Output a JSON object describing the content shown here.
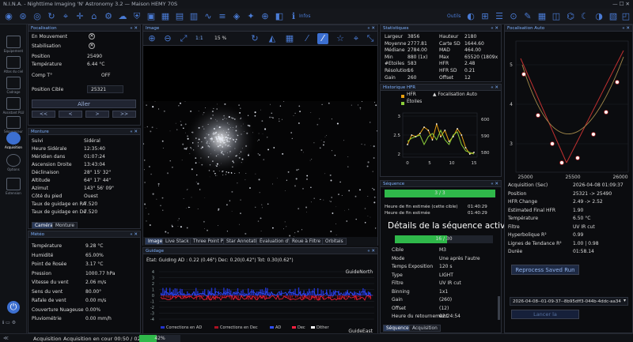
{
  "app": {
    "title": "N.I.N.A. - Nighttime Imaging 'N' Astronomy 3.2  —  Maison HEMY 70S",
    "outils": "Outils",
    "infos": "Infos"
  },
  "sidebar": {
    "items": [
      {
        "label": "Equipement"
      },
      {
        "label": "Atlas du ciel"
      },
      {
        "label": "Cadrage"
      },
      {
        "label": "Assistant PLU"
      },
      {
        "label": "Séquenceur"
      },
      {
        "label": "Acquisition"
      },
      {
        "label": "Options"
      },
      {
        "label": "Extension"
      }
    ]
  },
  "focuser": {
    "title": "Focalisation",
    "moving_label": "En Mouvement",
    "stab_label": "Stabilisation",
    "pos_label": "Position",
    "pos_value": "25490",
    "temp_label": "Température",
    "temp_value": "6.44 °C",
    "comp_label": "Comp T°",
    "comp_value": "OFF",
    "target_label": "Position Cible",
    "target_value": "25321",
    "aller": "Aller",
    "b1": "<<",
    "b2": "<",
    "b3": ">",
    "b4": ">>"
  },
  "mount": {
    "title": "Monture",
    "rows": [
      {
        "k": "Suivi",
        "v": "Sidéral"
      },
      {
        "k": "Heure Sidérale",
        "v": "12:35:40"
      },
      {
        "k": "Méridien dans",
        "v": "01:07:24"
      },
      {
        "k": "Ascension Droite",
        "v": "13:43:04"
      },
      {
        "k": "Déclinaison",
        "v": "28° 15' 32\""
      },
      {
        "k": "Altitude",
        "v": "64° 17' 44\""
      },
      {
        "k": "Azimut",
        "v": "143° 56' 09\""
      },
      {
        "k": "Côté du pied",
        "v": "Ouest"
      },
      {
        "k": "Taux de guidage en RA",
        "v": "7.520"
      },
      {
        "k": "Taux de guidage en De",
        "v": "7.520"
      }
    ],
    "tabs": [
      "Caméra",
      "Monture"
    ]
  },
  "weather": {
    "title": "Météo",
    "rows": [
      {
        "k": "Température",
        "v": "9.28 °C"
      },
      {
        "k": "Humidité",
        "v": "65.00%"
      },
      {
        "k": "Point de Rosée",
        "v": "3.17 °C"
      },
      {
        "k": "Pression",
        "v": "1000.77 hPa"
      },
      {
        "k": "Vitesse du vent",
        "v": "2.06 m/s"
      },
      {
        "k": "Sens du vent",
        "v": "80.00°"
      },
      {
        "k": "Rafale de vent",
        "v": "0.00 m/s"
      },
      {
        "k": "Couverture Nuageuse",
        "v": "0.00%"
      },
      {
        "k": "Pluviométrie",
        "v": "0.00 mm/h"
      }
    ]
  },
  "image": {
    "title": "Image",
    "zoom_fit": "1:1",
    "zoom_pct": "15 %",
    "tabs": [
      "Image",
      "Live Stack",
      "Three Point P",
      "Star Annotati",
      "Évaluation d'",
      "Roue à Filtre",
      "Orbitals"
    ]
  },
  "guiding": {
    "title": "Guidage",
    "status": "État: Guiding  AD : 0.22 (0.46\")  Dec: 0.20(0.42\")  Tot: 0.30(0.62\")",
    "north": "GuideNorth",
    "east": "GuideEast",
    "yticks": [
      "4",
      "3",
      "2",
      "1",
      "0",
      "-1",
      "-2",
      "-3",
      "-4"
    ],
    "legend": [
      "Corrections en AD",
      "Corrections en Dec",
      "AD",
      "Dec",
      "Dither"
    ]
  },
  "stats": {
    "title": "Statistiques",
    "rows": [
      {
        "k1": "Largeur",
        "v1": "3856",
        "k2": "Hauteur",
        "v2": "2180"
      },
      {
        "k1": "Moyenne",
        "v1": "2777.81",
        "k2": "Carte SD",
        "v2": "1644.60"
      },
      {
        "k1": "Médiane",
        "v1": "2784.00",
        "k2": "MAD",
        "v2": "464.00"
      },
      {
        "k1": "Min",
        "v1": "880 (1x)",
        "k2": "Max",
        "v2": "65520 (1809x"
      },
      {
        "k1": "#Etoiles",
        "v1": "583",
        "k2": "HFR",
        "v2": "2.48"
      },
      {
        "k1": "Résolution",
        "v1": "16",
        "k2": "HFR SD",
        "v2": "0.21"
      },
      {
        "k1": "Gain",
        "v1": "260",
        "k2": "Offset",
        "v2": "12"
      }
    ]
  },
  "hfr": {
    "title": "Historique HFR",
    "legend_hfr": "HFR",
    "legend_af": "Focalisation Auto",
    "legend_stars": "Étoiles",
    "left_ticks": [
      "3",
      "2.5",
      "2"
    ],
    "right_ticks": [
      "600",
      "590",
      "580"
    ],
    "x_ticks": [
      "0",
      "5",
      "10",
      "15"
    ]
  },
  "sequence": {
    "title": "Séquence",
    "progress_label": "3 / 3",
    "progress": 1.0,
    "end_target_label": "Heure de fin estimée (cette cible)",
    "end_target_value": "01:40:29",
    "end_label": "Heure de fin estimée",
    "end_value": "01:40:29",
    "heading": "Détails de la séquence active",
    "sub_progress_label": "16 / 30",
    "sub_progress": 0.533,
    "rows": [
      {
        "k": "Cible",
        "v": "M3"
      },
      {
        "k": "Mode",
        "v": "Une après l'autre"
      },
      {
        "k": "Temps Exposition",
        "v": "120 s"
      },
      {
        "k": "Type",
        "v": "LIGHT"
      },
      {
        "k": "Filtre",
        "v": "UV IR cut"
      },
      {
        "k": "Binning",
        "v": "1x1"
      },
      {
        "k": "Gain",
        "v": "(260)"
      },
      {
        "k": "Offset",
        "v": "(12)"
      },
      {
        "k": "Heure du retournement",
        "v": "02:24:54"
      }
    ],
    "tabs": [
      "Séquence",
      "Acquisition"
    ]
  },
  "autofocus": {
    "title": "Focalisation Auto",
    "y_ticks": [
      "5",
      "4",
      "3"
    ],
    "x_ticks": [
      "25000",
      "25500",
      "26000"
    ],
    "rows": [
      {
        "k": "Acquisition (Sec)",
        "v": "2026-04-08 01:09:37"
      },
      {
        "k": "Position",
        "v": "25321 -> 25490"
      },
      {
        "k": "HFR Change",
        "v": "2.49 -> 2.52"
      },
      {
        "k": "Estimated Final HFR",
        "v": "1.90"
      },
      {
        "k": "Température",
        "v": "6.50 °C"
      },
      {
        "k": "Filtre",
        "v": "UV IR cut"
      },
      {
        "k": "Hyperbolique R²",
        "v": "0.99"
      },
      {
        "k": "Lignes de Tendance R²",
        "v": "1.00 | 0.98"
      },
      {
        "k": "Durée",
        "v": "01:58.14"
      }
    ],
    "reprocess": "Reprocess Saved Run",
    "saved_run": "2026-04-08--01-09-37--8b95dff3-044b-4ddc-aa34",
    "load": "Lancer la"
  },
  "status": {
    "label": "Acquisition",
    "text": "Acquisition en cour 00:50 / 02:00",
    "pct_label": "42%",
    "progress": 0.42
  },
  "colors": {
    "accent": "#3c6fd0",
    "green": "#2fb84a",
    "bg": "#0b0c0f"
  }
}
